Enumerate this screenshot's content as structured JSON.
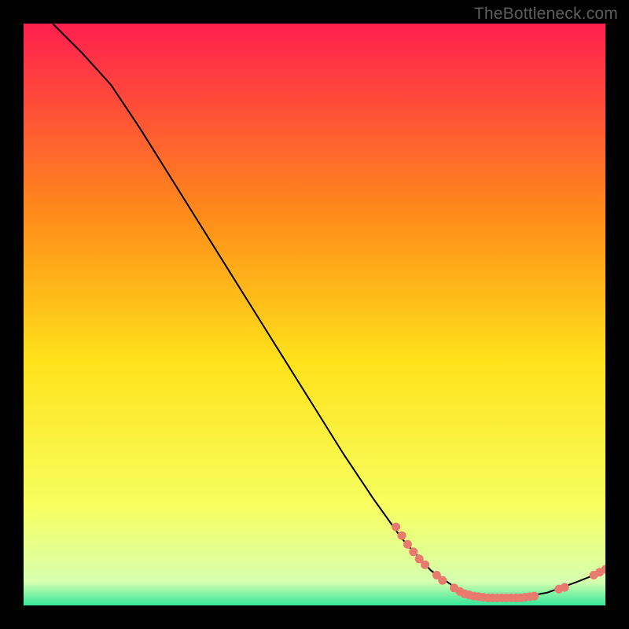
{
  "watermark": "TheBottleneck.com",
  "chart_data": {
    "type": "line",
    "title": "",
    "xlabel": "",
    "ylabel": "",
    "xlim": [
      0,
      100
    ],
    "ylim": [
      0,
      100
    ],
    "gradient_colors": {
      "top": "#ff1f4f",
      "mid_upper": "#ff8c1a",
      "mid": "#ffe21a",
      "mid_lower": "#f7ff60",
      "bottom": "#34e79a"
    },
    "curve": [
      {
        "x": 5,
        "y": 100
      },
      {
        "x": 10,
        "y": 95
      },
      {
        "x": 15,
        "y": 89.5
      },
      {
        "x": 20,
        "y": 82
      },
      {
        "x": 25,
        "y": 74
      },
      {
        "x": 30,
        "y": 66
      },
      {
        "x": 35,
        "y": 58
      },
      {
        "x": 40,
        "y": 50
      },
      {
        "x": 45,
        "y": 42
      },
      {
        "x": 50,
        "y": 34
      },
      {
        "x": 55,
        "y": 26
      },
      {
        "x": 60,
        "y": 18.5
      },
      {
        "x": 65,
        "y": 11.5
      },
      {
        "x": 70,
        "y": 6
      },
      {
        "x": 75,
        "y": 2.5
      },
      {
        "x": 80,
        "y": 1.3
      },
      {
        "x": 85,
        "y": 1.3
      },
      {
        "x": 90,
        "y": 2.2
      },
      {
        "x": 95,
        "y": 4
      },
      {
        "x": 100,
        "y": 6
      }
    ],
    "markers": [
      {
        "x": 64,
        "y": 13.5
      },
      {
        "x": 65,
        "y": 12
      },
      {
        "x": 66,
        "y": 10.5
      },
      {
        "x": 67,
        "y": 9.2
      },
      {
        "x": 68,
        "y": 8
      },
      {
        "x": 69,
        "y": 7
      },
      {
        "x": 71,
        "y": 5.2
      },
      {
        "x": 72,
        "y": 4.3
      },
      {
        "x": 74,
        "y": 3
      },
      {
        "x": 75,
        "y": 2.4
      },
      {
        "x": 75.8,
        "y": 2
      },
      {
        "x": 76.6,
        "y": 1.8
      },
      {
        "x": 77.4,
        "y": 1.6
      },
      {
        "x": 78.2,
        "y": 1.5
      },
      {
        "x": 79,
        "y": 1.4
      },
      {
        "x": 79.8,
        "y": 1.3
      },
      {
        "x": 80.6,
        "y": 1.3
      },
      {
        "x": 81.4,
        "y": 1.3
      },
      {
        "x": 82.2,
        "y": 1.3
      },
      {
        "x": 83,
        "y": 1.3
      },
      {
        "x": 83.8,
        "y": 1.3
      },
      {
        "x": 84.6,
        "y": 1.3
      },
      {
        "x": 85.4,
        "y": 1.3
      },
      {
        "x": 86.2,
        "y": 1.4
      },
      {
        "x": 87,
        "y": 1.5
      },
      {
        "x": 87.8,
        "y": 1.6
      },
      {
        "x": 92,
        "y": 2.8
      },
      {
        "x": 93,
        "y": 3.1
      },
      {
        "x": 98,
        "y": 5.2
      },
      {
        "x": 99,
        "y": 5.7
      },
      {
        "x": 100,
        "y": 6.2
      }
    ],
    "marker_color": "#e87a6e",
    "curve_color": "#000000"
  }
}
